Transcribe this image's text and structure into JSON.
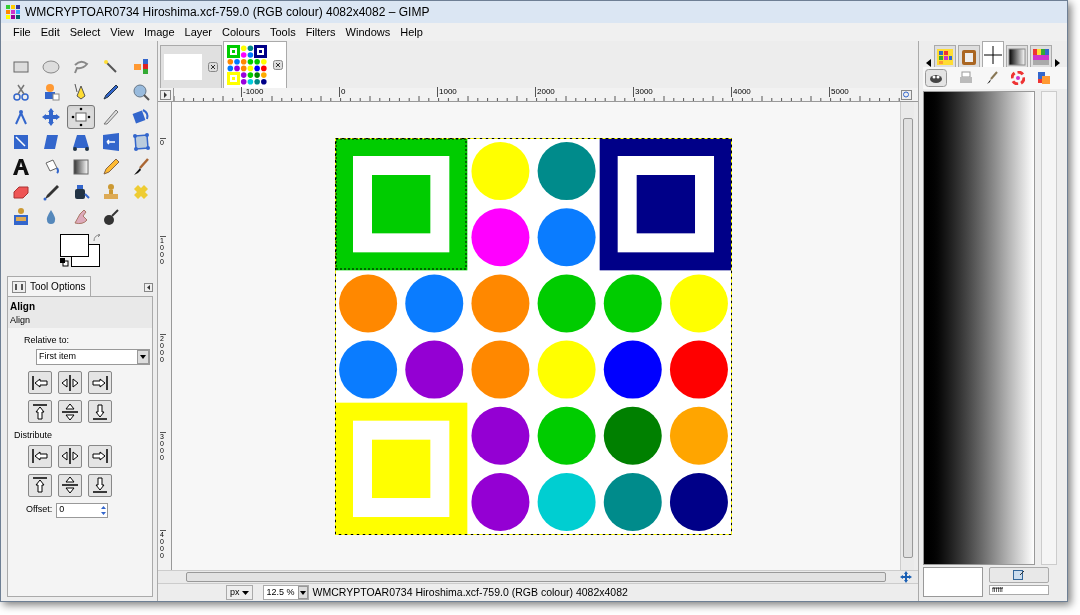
{
  "window": {
    "title": "WMCRYPTOAR0734 Hiroshima.xcf-759.0 (RGB colour) 4082x4082 – GIMP"
  },
  "menu": [
    "File",
    "Edit",
    "Select",
    "View",
    "Image",
    "Layer",
    "Colours",
    "Tools",
    "Filters",
    "Windows",
    "Help"
  ],
  "image_tabs": [
    {
      "selected": false
    },
    {
      "selected": true
    }
  ],
  "toolbox": {
    "tools": [
      {
        "selected": false
      },
      {
        "selected": false
      },
      {
        "selected": false
      },
      {
        "selected": false
      },
      {
        "selected": false
      },
      {
        "selected": false
      },
      {
        "selected": false
      },
      {
        "selected": false
      },
      {
        "selected": false
      },
      {
        "selected": false
      },
      {
        "selected": false
      },
      {
        "selected": false
      },
      {
        "selected": true
      },
      {
        "selected": false
      },
      {
        "selected": false
      },
      {
        "selected": false
      },
      {
        "selected": false
      },
      {
        "selected": false
      },
      {
        "selected": false
      },
      {
        "selected": false
      },
      {
        "selected": false
      },
      {
        "selected": false
      },
      {
        "selected": false
      },
      {
        "selected": false
      },
      {
        "selected": false
      },
      {
        "selected": false
      },
      {
        "selected": false
      },
      {
        "selected": false
      },
      {
        "selected": false
      },
      {
        "selected": false
      },
      {
        "selected": false
      },
      {
        "selected": false
      },
      {
        "selected": false
      },
      {
        "selected": false
      }
    ]
  },
  "tool_options": {
    "tab": "Tool Options",
    "title": "Align",
    "section": "Align",
    "relative_label": "Relative to:",
    "relative_value": "First item",
    "distribute_label": "Distribute",
    "offset_label": "Offset:",
    "offset_value": "0"
  },
  "rulers": {
    "horizontal": [
      "-1000",
      "0",
      "1000",
      "2000",
      "3000",
      "4000",
      "5000"
    ],
    "vertical": [
      "0",
      "1000",
      "2000",
      "3000",
      "4000"
    ]
  },
  "status_bar": {
    "unit": "px",
    "zoom": "12.5 %",
    "info": "WMCRYPTOAR0734 Hiroshima.xcf-759.0 (RGB colour) 4082x4082"
  },
  "right_panel": {
    "tabs": [
      {
        "selected": false
      },
      {
        "selected": false
      },
      {
        "selected": true
      },
      {
        "selected": false
      },
      {
        "selected": false
      }
    ],
    "hex": "ffffff"
  }
}
